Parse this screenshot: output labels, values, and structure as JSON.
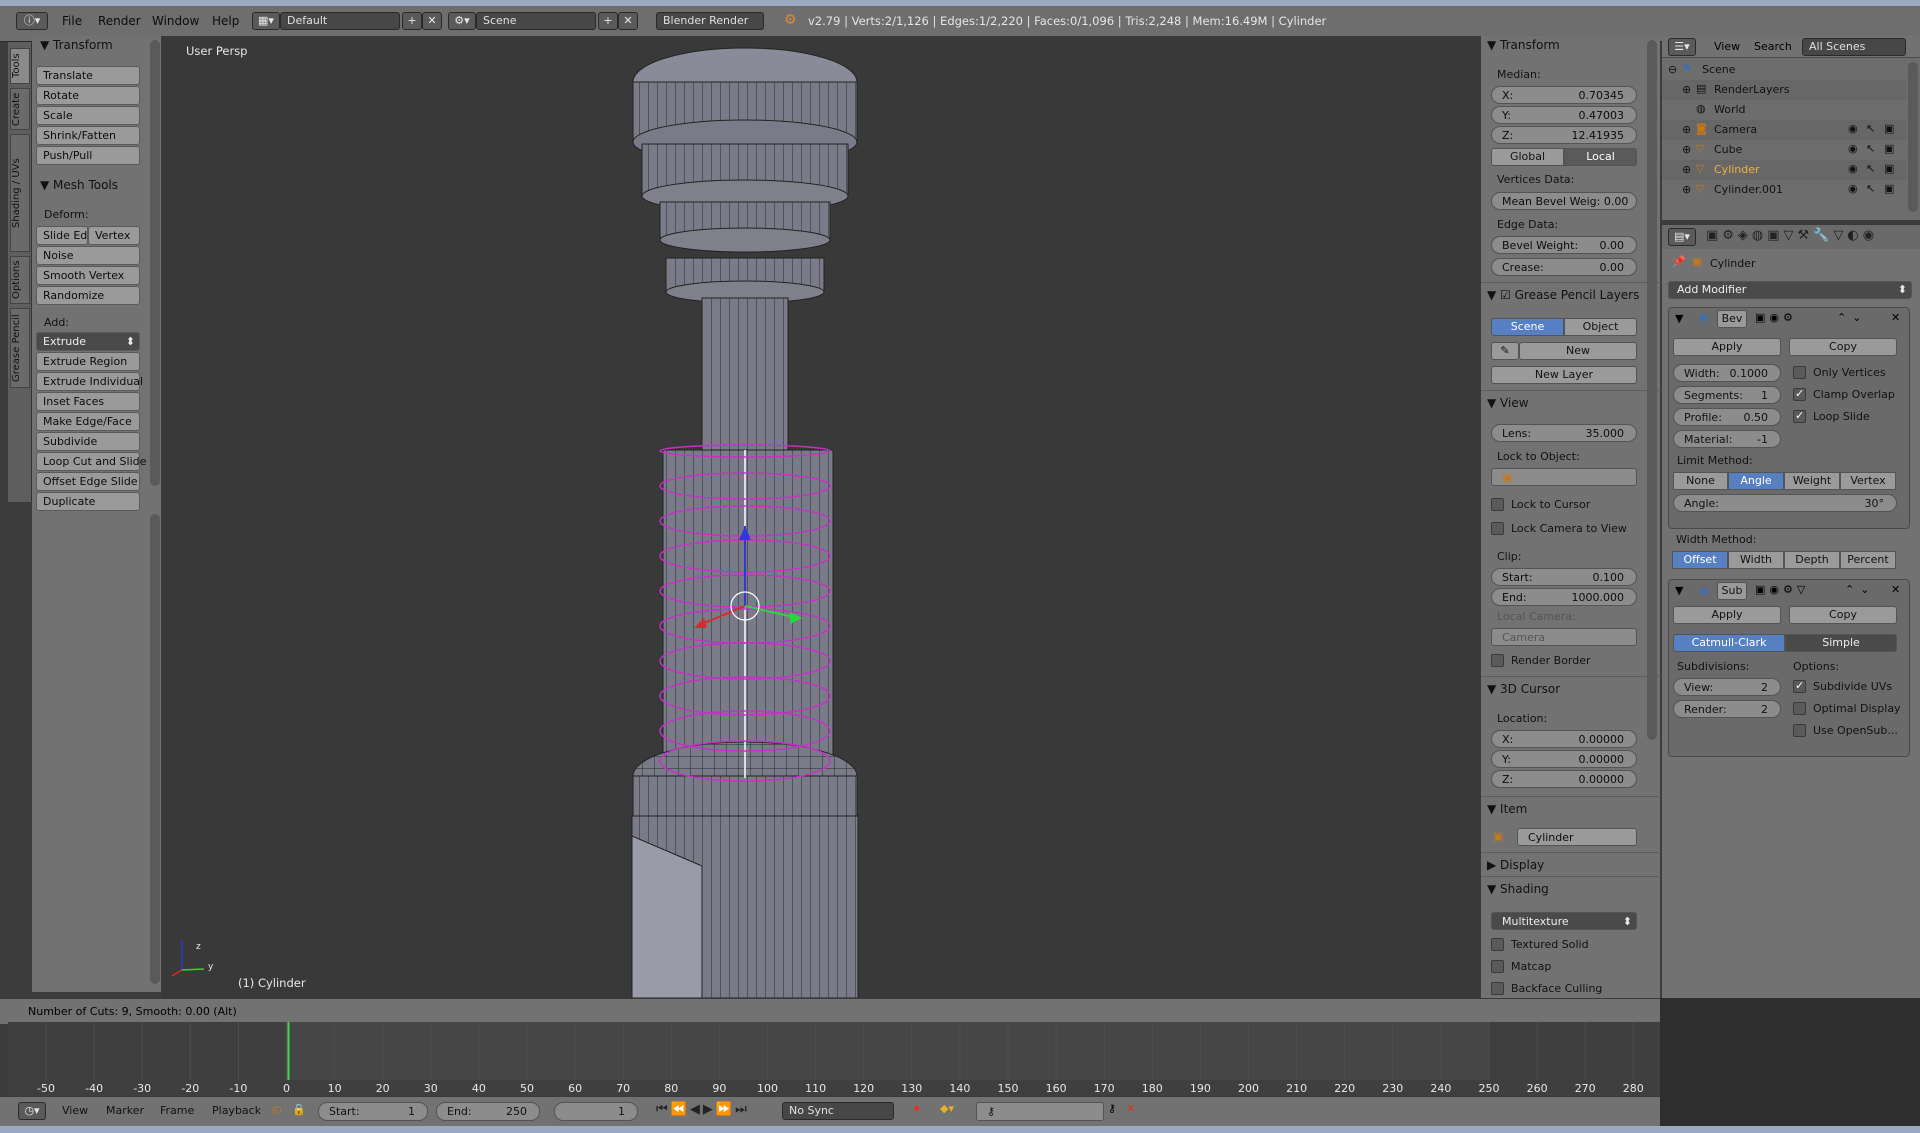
{
  "topbar": {
    "menus": [
      "File",
      "Render",
      "Window",
      "Help"
    ],
    "screen_layout": "Default",
    "scene": "Scene",
    "engine": "Blender Render",
    "info": "v2.79 | Verts:2/1,126 | Edges:1/2,220 | Faces:0/1,096 | Tris:2,248 | Mem:16.49M | Cylinder"
  },
  "left_tabs": [
    "Tools",
    "Create",
    "Shading / UVs",
    "Options",
    "Grease Pencil"
  ],
  "toolshelf": {
    "transform_header": "Transform",
    "transform_buttons": [
      "Translate",
      "Rotate",
      "Scale",
      "Shrink/Fatten",
      "Push/Pull"
    ],
    "mesh_tools_header": "Mesh Tools",
    "deform_label": "Deform:",
    "slide_edge": "Slide Ed",
    "vertex": "Vertex",
    "deform_buttons": [
      "Noise",
      "Smooth Vertex",
      "Randomize"
    ],
    "add_label": "Add:",
    "extrude": "Extrude",
    "add_buttons": [
      "Extrude Region",
      "Extrude Individual",
      "Inset Faces",
      "Make Edge/Face",
      "Subdivide",
      "Loop Cut and Slide",
      "Offset Edge Slide",
      "Duplicate"
    ]
  },
  "viewport": {
    "persp_label": "User Persp",
    "object_label": "(1) Cylinder",
    "axis_x": "x",
    "axis_y": "y",
    "axis_z": "z"
  },
  "npanel": {
    "transform_header": "Transform",
    "median_label": "Median:",
    "x_label": "X:",
    "x_value": "0.70345",
    "y_label": "Y:",
    "y_value": "0.47003",
    "z_label": "Z:",
    "z_value": "12.41935",
    "global": "Global",
    "local": "Local",
    "vertices_data": "Vertices Data:",
    "mean_bevel": "Mean Bevel Weig: 0.00",
    "edge_data": "Edge Data:",
    "bevel_weight_label": "Bevel Weight:",
    "bevel_weight_value": "0.00",
    "crease_label": "Crease:",
    "crease_value": "0.00",
    "grease_header": "Grease Pencil Layers",
    "scene": "Scene",
    "object": "Object",
    "new": "New",
    "new_layer": "New Layer",
    "view_header": "View",
    "lens_label": "Lens:",
    "lens_value": "35.000",
    "lock_to_object": "Lock to Object:",
    "lock_to_cursor": "Lock to Cursor",
    "lock_camera": "Lock Camera to View",
    "clip_label": "Clip:",
    "start_label": "Start:",
    "start_value": "0.100",
    "end_label": "End:",
    "end_value": "1000.000",
    "local_camera": "Local Camera:",
    "camera": "Camera",
    "render_border": "Render Border",
    "cursor_header": "3D Cursor",
    "location_label": "Location:",
    "cx_label": "X:",
    "cx_value": "0.00000",
    "cy_label": "Y:",
    "cy_value": "0.00000",
    "cz_label": "Z:",
    "cz_value": "0.00000",
    "item_header": "Item",
    "item_name": "Cylinder",
    "display_header": "Display",
    "shading_header": "Shading",
    "shading_mode": "Multitexture",
    "textured_solid": "Textured Solid",
    "matcap": "Matcap",
    "backface": "Backface Culling"
  },
  "outliner": {
    "view": "View",
    "search": "Search",
    "all_scenes": "All Scenes",
    "rows": [
      "Scene",
      "RenderLayers",
      "World",
      "Camera",
      "Cube",
      "Cylinder",
      "Cylinder.001"
    ]
  },
  "properties": {
    "object_name": "Cylinder",
    "add_modifier": "Add Modifier",
    "bevel": {
      "name": "Bev",
      "apply": "Apply",
      "copy": "Copy",
      "width_label": "Width:",
      "width_value": "0.1000",
      "segments_label": "Segments:",
      "segments_value": "1",
      "profile_label": "Profile:",
      "profile_value": "0.50",
      "material_label": "Material:",
      "material_value": "-1",
      "only_vertices": "Only Vertices",
      "clamp_overlap": "Clamp Overlap",
      "loop_slide": "Loop Slide",
      "limit_method": "Limit Method:",
      "limit_none": "None",
      "limit_angle": "Angle",
      "limit_weight": "Weight",
      "limit_vertex": "Vertex G...",
      "angle_label": "Angle:",
      "angle_value": "30°",
      "width_method": "Width Method:",
      "wm_offset": "Offset",
      "wm_width": "Width",
      "wm_depth": "Depth",
      "wm_percent": "Percent"
    },
    "subsurf": {
      "name": "Sub",
      "apply": "Apply",
      "copy": "Copy",
      "catmull": "Catmull-Clark",
      "simple": "Simple",
      "subdivisions": "Subdivisions:",
      "options": "Options:",
      "view_label": "View:",
      "view_value": "2",
      "render_label": "Render:",
      "render_value": "2",
      "subdivide_uvs": "Subdivide UVs",
      "optimal_display": "Optimal Display",
      "use_opensub": "Use OpenSub..."
    }
  },
  "status": "Number of Cuts: 9, Smooth: 0.00 (Alt)",
  "timeline": {
    "ticks": [
      "-50",
      "-40",
      "-30",
      "-20",
      "-10",
      "0",
      "10",
      "20",
      "30",
      "40",
      "50",
      "60",
      "70",
      "80",
      "90",
      "100",
      "110",
      "120",
      "130",
      "140",
      "150",
      "160",
      "170",
      "180",
      "190",
      "200",
      "210",
      "220",
      "230",
      "240",
      "250",
      "260",
      "270",
      "280"
    ],
    "view": "View",
    "marker": "Marker",
    "frame": "Frame",
    "playback": "Playback",
    "start_label": "Start:",
    "start_value": "1",
    "end_label": "End:",
    "end_value": "250",
    "current": "1",
    "sync": "No Sync"
  }
}
